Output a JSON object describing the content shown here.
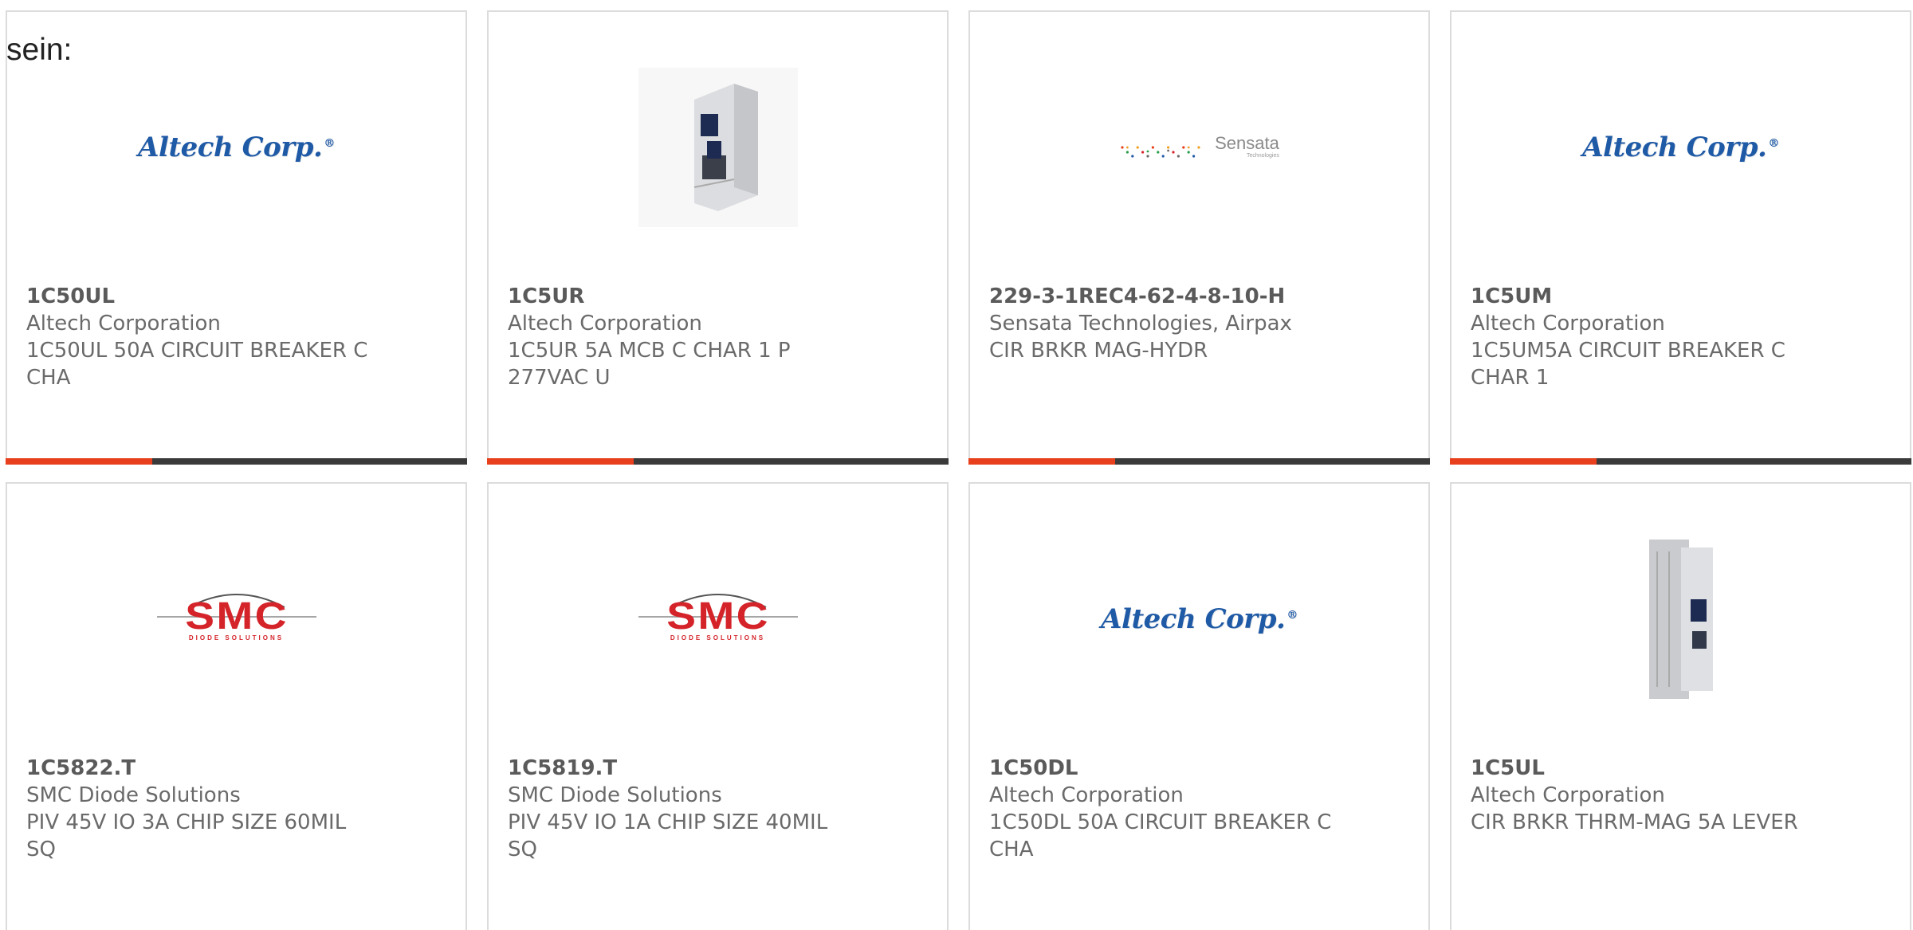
{
  "intro_text": "sein:",
  "colors": {
    "accent_bar": "#e8401c",
    "bar_dark": "#3a3a3a",
    "altech_blue": "#1f5aa6",
    "smc_red": "#d4242a",
    "text_gray": "#6a6a6a"
  },
  "logos": {
    "altech": {
      "text": "Altech Corp.",
      "mark": "®"
    },
    "sensata": {
      "text": "Sensata",
      "sub": "Technologies"
    },
    "smc": {
      "text": "SMC",
      "sub": "DIODE SOLUTIONS"
    }
  },
  "products": [
    {
      "part": "1C50UL",
      "manufacturer": "Altech Corporation",
      "description": "1C50UL 50A CIRCUIT BREAKER C CHA",
      "image": "altech-logo"
    },
    {
      "part": "1C5UR",
      "manufacturer": "Altech Corporation",
      "description": "1C5UR 5A MCB C CHAR 1 P 277VAC U",
      "image": "circuit-breaker-photo"
    },
    {
      "part": "229-3-1REC4-62-4-8-10-H",
      "manufacturer": "Sensata Technologies, Airpax",
      "description": "CIR BRKR MAG-HYDR",
      "image": "sensata-logo"
    },
    {
      "part": "1C5UM",
      "manufacturer": "Altech Corporation",
      "description": "1C5UM5A CIRCUIT BREAKER C CHAR 1",
      "image": "altech-logo"
    },
    {
      "part": "1C5822.T",
      "manufacturer": "SMC Diode Solutions",
      "description": "PIV 45V IO 3A CHIP SIZE 60MIL SQ",
      "image": "smc-logo"
    },
    {
      "part": "1C5819.T",
      "manufacturer": "SMC Diode Solutions",
      "description": "PIV 45V IO 1A CHIP SIZE 40MIL SQ",
      "image": "smc-logo"
    },
    {
      "part": "1C50DL",
      "manufacturer": "Altech Corporation",
      "description": "1C50DL 50A CIRCUIT BREAKER C CHA",
      "image": "altech-logo"
    },
    {
      "part": "1C5UL",
      "manufacturer": "Altech Corporation",
      "description": "CIR BRKR THRM-MAG 5A LEVER",
      "image": "circuit-breaker-side-photo"
    }
  ]
}
